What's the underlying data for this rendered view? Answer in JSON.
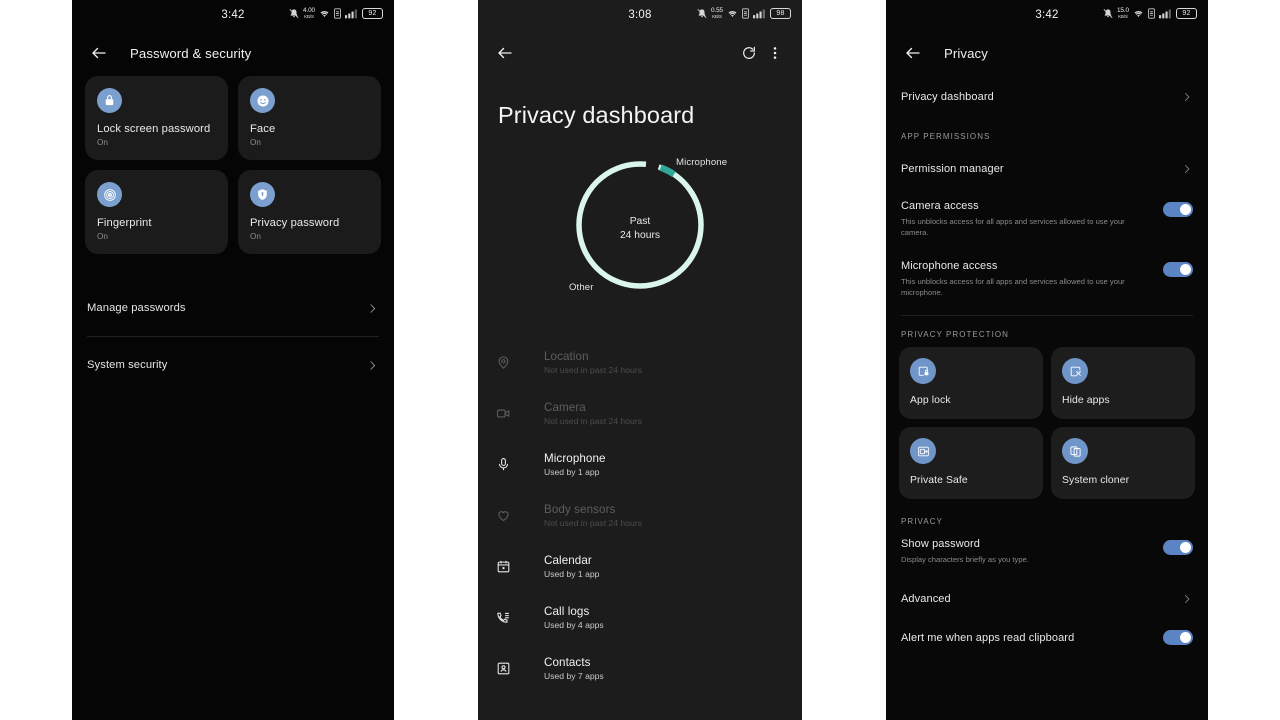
{
  "panel1": {
    "status": {
      "time": "3:42",
      "net_speed_value": "4.00",
      "net_speed_unit": "KB/S",
      "battery": "92"
    },
    "toolbar": {
      "back_icon": "arrow-back-icon",
      "title": "Password & security"
    },
    "cards": [
      {
        "icon": "lock-icon",
        "title": "Lock screen password",
        "sub": "On"
      },
      {
        "icon": "face-icon",
        "title": "Face",
        "sub": "On"
      },
      {
        "icon": "fingerprint-icon",
        "title": "Fingerprint",
        "sub": "On"
      },
      {
        "icon": "shield-lock-icon",
        "title": "Privacy password",
        "sub": "On"
      }
    ],
    "rows": [
      {
        "label": "Manage passwords",
        "chevron": "chevron-right-icon"
      },
      {
        "label": "System security",
        "chevron": "chevron-right-icon"
      }
    ]
  },
  "panel2": {
    "status": {
      "time": "3:08",
      "net_speed_value": "0.55",
      "net_speed_unit": "KB/S",
      "battery": "98"
    },
    "toolbar": {
      "back_icon": "arrow-back-icon",
      "refresh_icon": "refresh-icon",
      "more_icon": "more-vertical-icon"
    },
    "title": "Privacy dashboard",
    "chart_data": {
      "type": "pie",
      "title": "Past 24 hours",
      "center_line1": "Past",
      "center_line2": "24 hours",
      "categories": [
        "Microphone",
        "Other"
      ],
      "values": [
        4,
        96
      ],
      "colors": [
        "#2fa89a",
        "#d9f5ee"
      ],
      "labels": [
        "Microphone",
        "Other"
      ],
      "legend": "inline-labels",
      "donut": true
    },
    "permissions": [
      {
        "icon": "location-pin-icon",
        "name": "Location",
        "sub": "Not used in past 24 hours",
        "used": false
      },
      {
        "icon": "camera-icon",
        "name": "Camera",
        "sub": "Not used in past 24 hours",
        "used": false
      },
      {
        "icon": "microphone-icon",
        "name": "Microphone",
        "sub": "Used by 1 app",
        "used": true
      },
      {
        "icon": "heart-icon",
        "name": "Body sensors",
        "sub": "Not used in past 24 hours",
        "used": false
      },
      {
        "icon": "calendar-icon",
        "name": "Calendar",
        "sub": "Used by 1 app",
        "used": true
      },
      {
        "icon": "call-logs-icon",
        "name": "Call logs",
        "sub": "Used by 4 apps",
        "used": true
      },
      {
        "icon": "contacts-icon",
        "name": "Contacts",
        "sub": "Used by 7 apps",
        "used": true
      }
    ]
  },
  "panel3": {
    "status": {
      "time": "3:42",
      "net_speed_value": "15.0",
      "net_speed_unit": "KB/S",
      "battery": "92"
    },
    "toolbar": {
      "back_icon": "arrow-back-icon",
      "title": "Privacy"
    },
    "dashboard_row": {
      "label": "Privacy dashboard",
      "chevron": "chevron-right-icon"
    },
    "app_permissions_header": "APP PERMISSIONS",
    "permission_manager_row": {
      "label": "Permission manager",
      "chevron": "chevron-right-icon"
    },
    "toggles_top": [
      {
        "title": "Camera access",
        "desc": "This unblocks access for all apps and services allowed to use your camera.",
        "on": true
      },
      {
        "title": "Microphone access",
        "desc": "This unblocks access for all apps and services allowed to use your microphone.",
        "on": true
      }
    ],
    "privacy_protection_header": "PRIVACY PROTECTION",
    "protection_cards": [
      {
        "icon": "app-lock-icon",
        "title": "App lock"
      },
      {
        "icon": "hide-apps-icon",
        "title": "Hide apps"
      },
      {
        "icon": "private-safe-icon",
        "title": "Private Safe"
      },
      {
        "icon": "system-cloner-icon",
        "title": "System cloner"
      }
    ],
    "privacy_header": "PRIVACY",
    "show_password": {
      "title": "Show password",
      "desc": "Display characters briefly as you type.",
      "on": true
    },
    "advanced_row": {
      "label": "Advanced",
      "chevron": "chevron-right-icon"
    },
    "clipboard_toggle": {
      "title": "Alert me when apps read clipboard",
      "on": true
    }
  },
  "theme": {
    "accent_blue": "#6f95c9",
    "switch_on": "#5b84c4",
    "donut_other": "#d9f5ee",
    "donut_mic": "#2fa89a"
  }
}
